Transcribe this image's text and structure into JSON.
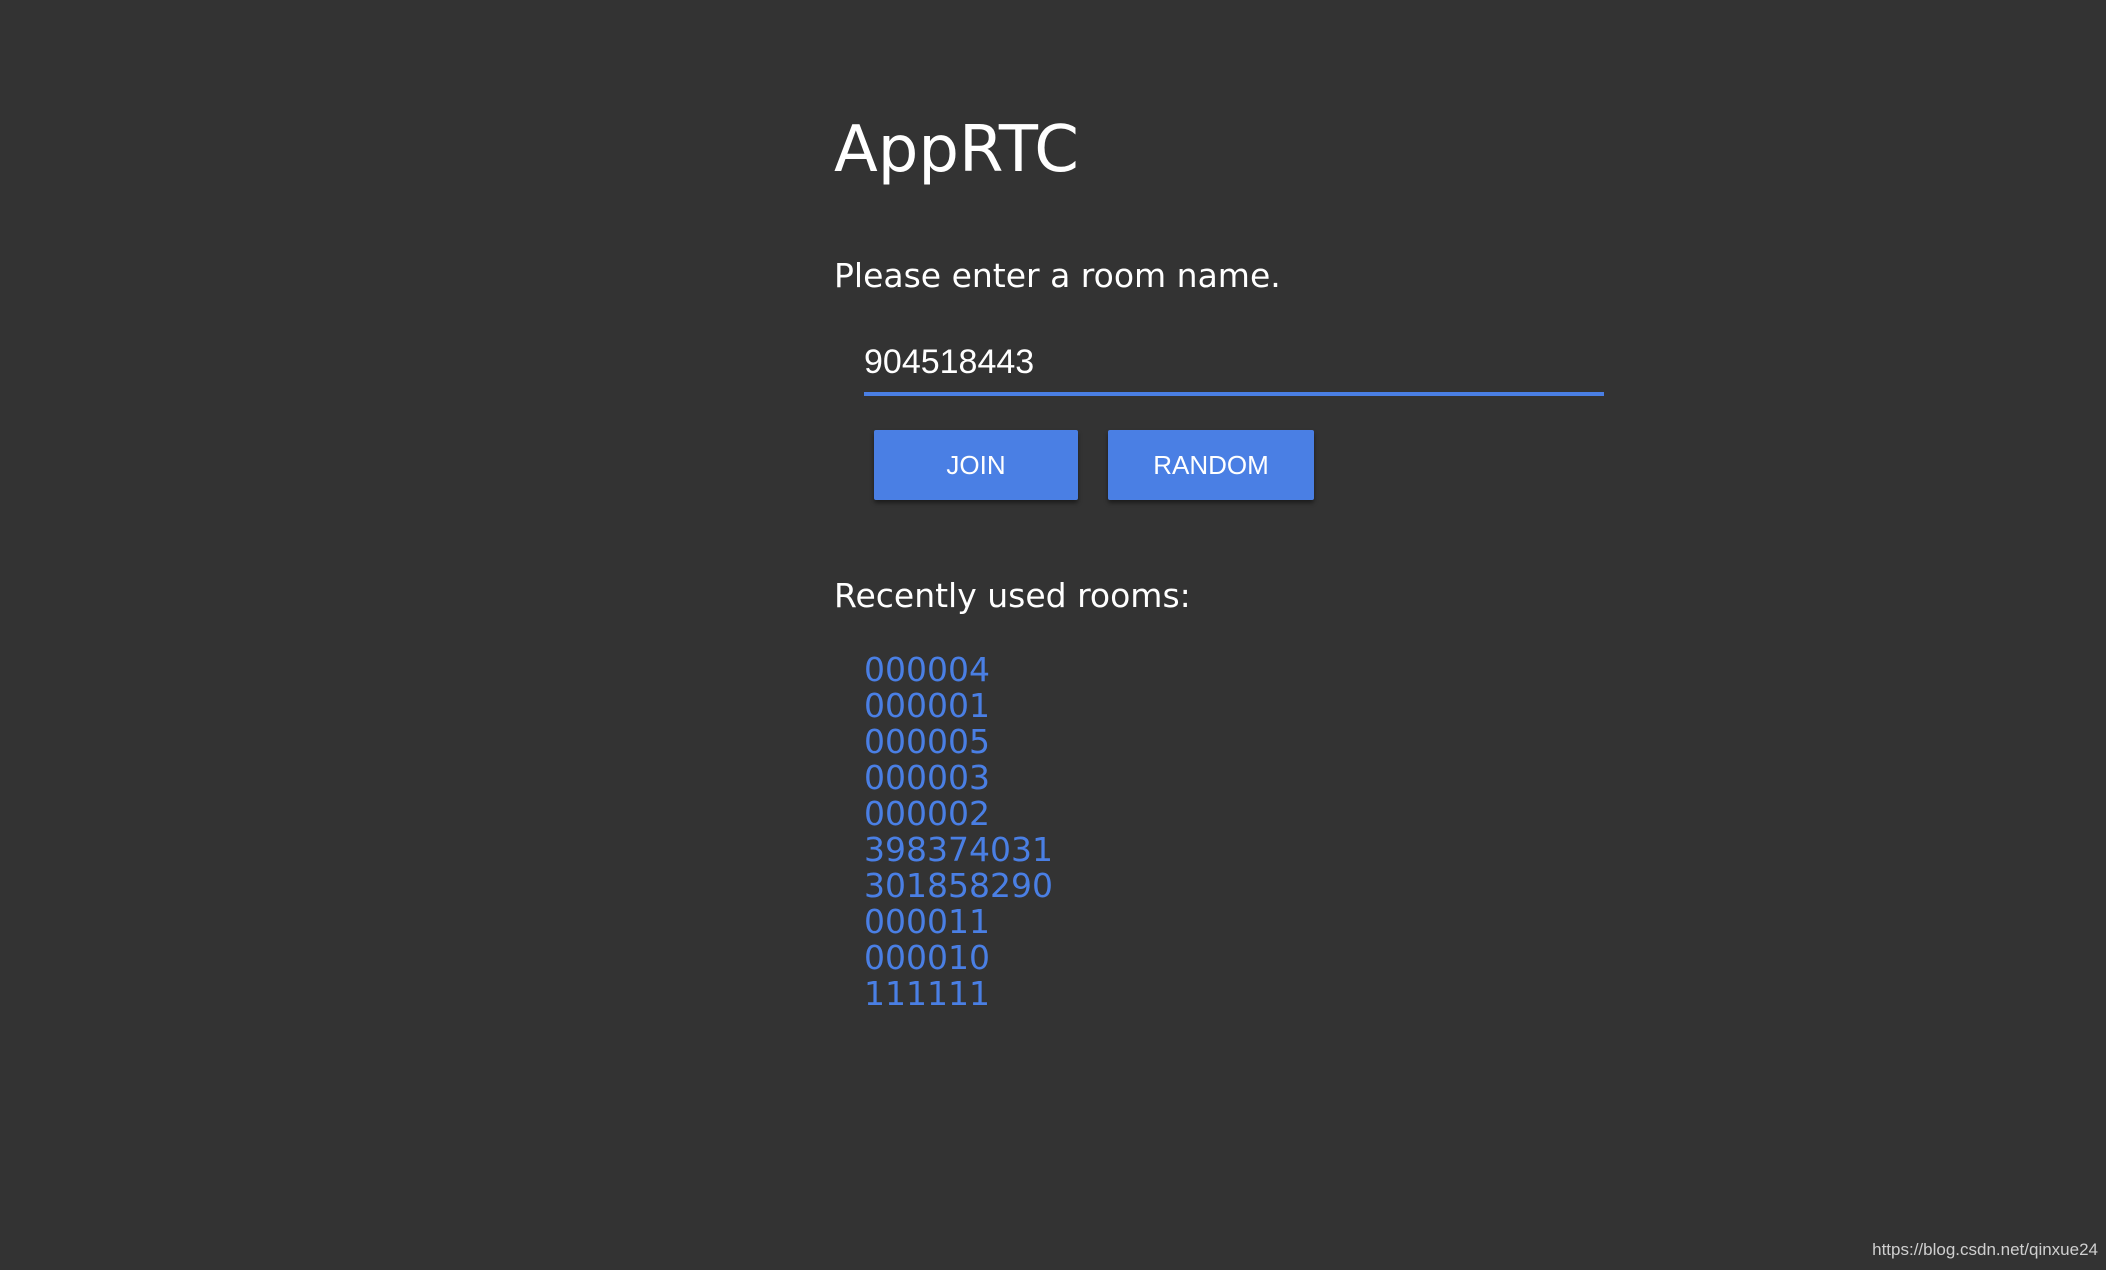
{
  "app": {
    "title": "AppRTC",
    "prompt": "Please enter a room name."
  },
  "room_input": {
    "value": "904518443"
  },
  "buttons": {
    "join": "JOIN",
    "random": "RANDOM"
  },
  "recent": {
    "heading": "Recently used rooms:",
    "rooms": [
      "000004",
      "000001",
      "000005",
      "000003",
      "000002",
      "398374031",
      "301858290",
      "000011",
      "000010",
      "111111"
    ]
  },
  "watermark": "https://blog.csdn.net/qinxue24",
  "colors": {
    "background": "#333333",
    "accent": "#4a7fe4",
    "text": "#ffffff"
  }
}
